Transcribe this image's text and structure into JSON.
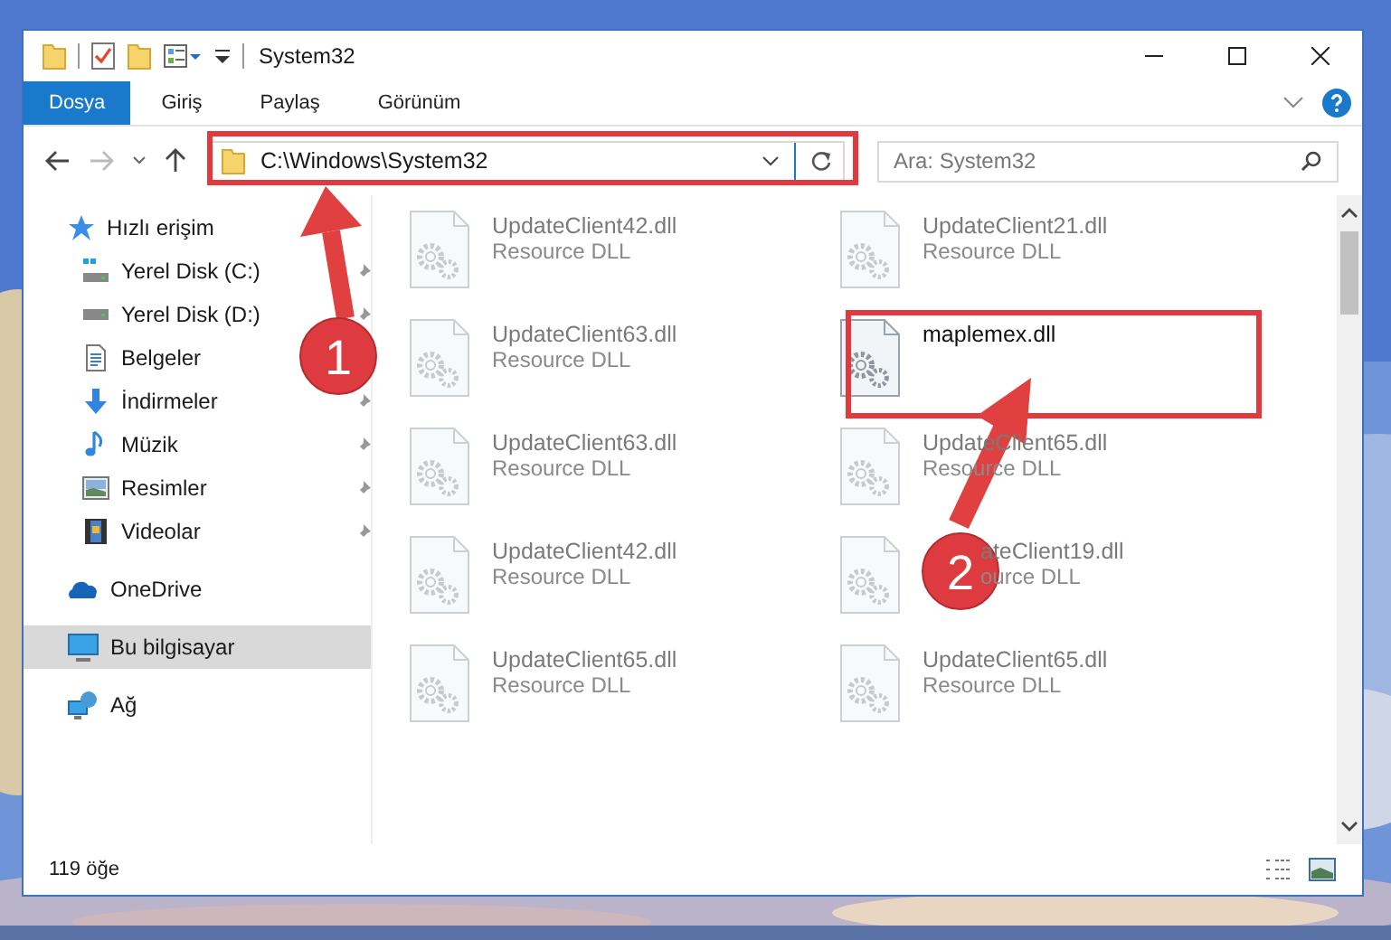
{
  "window": {
    "title": "System32"
  },
  "ribbon_tabs": [
    {
      "label": "Dosya",
      "selected": true
    },
    {
      "label": "Giriş",
      "selected": false
    },
    {
      "label": "Paylaş",
      "selected": false
    },
    {
      "label": "Görünüm",
      "selected": false
    }
  ],
  "address_bar": {
    "path": "C:\\Windows\\System32"
  },
  "search": {
    "placeholder": "Ara: System32"
  },
  "nav_pane": [
    {
      "label": "Hızlı erişim",
      "kind": "star",
      "pinned": false,
      "selected": false,
      "children": [
        {
          "label": "Yerel Disk (C:)",
          "kind": "drive-c",
          "pinned": true,
          "selected": false
        },
        {
          "label": "Yerel Disk (D:)",
          "kind": "drive",
          "pinned": true,
          "selected": false
        },
        {
          "label": "Belgeler",
          "kind": "docs",
          "pinned": false,
          "selected": false
        },
        {
          "label": "İndirmeler",
          "kind": "download",
          "pinned": true,
          "selected": false
        },
        {
          "label": "Müzik",
          "kind": "music",
          "pinned": true,
          "selected": false
        },
        {
          "label": "Resimler",
          "kind": "pictures",
          "pinned": true,
          "selected": false
        },
        {
          "label": "Videolar",
          "kind": "videos",
          "pinned": true,
          "selected": false
        }
      ]
    },
    {
      "label": "OneDrive",
      "kind": "cloud",
      "pinned": false,
      "selected": false
    },
    {
      "label": "Bu bilgisayar",
      "kind": "pc",
      "pinned": false,
      "selected": true
    },
    {
      "label": "Ağ",
      "kind": "network",
      "pinned": false,
      "selected": false
    }
  ],
  "files": [
    {
      "name": "UpdateClient42.dll",
      "type": "Resource DLL",
      "blurred": true
    },
    {
      "name": "UpdateClient21.dll",
      "type": "Resource DLL",
      "blurred": true
    },
    {
      "name": "UpdateClient63.dll",
      "type": "Resource DLL",
      "blurred": true
    },
    {
      "name": "maplemex.dll",
      "blurred": false
    },
    {
      "name": "UpdateClient63.dll",
      "type": "Resource DLL",
      "blurred": true
    },
    {
      "name": "UpdateClient65.dll",
      "type": "Resource DLL",
      "blurred": true
    },
    {
      "name": "UpdateClient42.dll",
      "type": "Resource DLL",
      "blurred": true
    },
    {
      "name": "ateClient19.dll",
      "type": "ource DLL",
      "blurred": true,
      "partly_hidden": true
    },
    {
      "name": "UpdateClient65.dll",
      "type": "Resource DLL",
      "blurred": true
    },
    {
      "name": "UpdateClient65.dll",
      "type": "Resource DLL",
      "blurred": true
    }
  ],
  "status_bar": {
    "item_count": "119 öğe"
  },
  "annotations": [
    {
      "number": "1"
    },
    {
      "number": "2"
    }
  ]
}
